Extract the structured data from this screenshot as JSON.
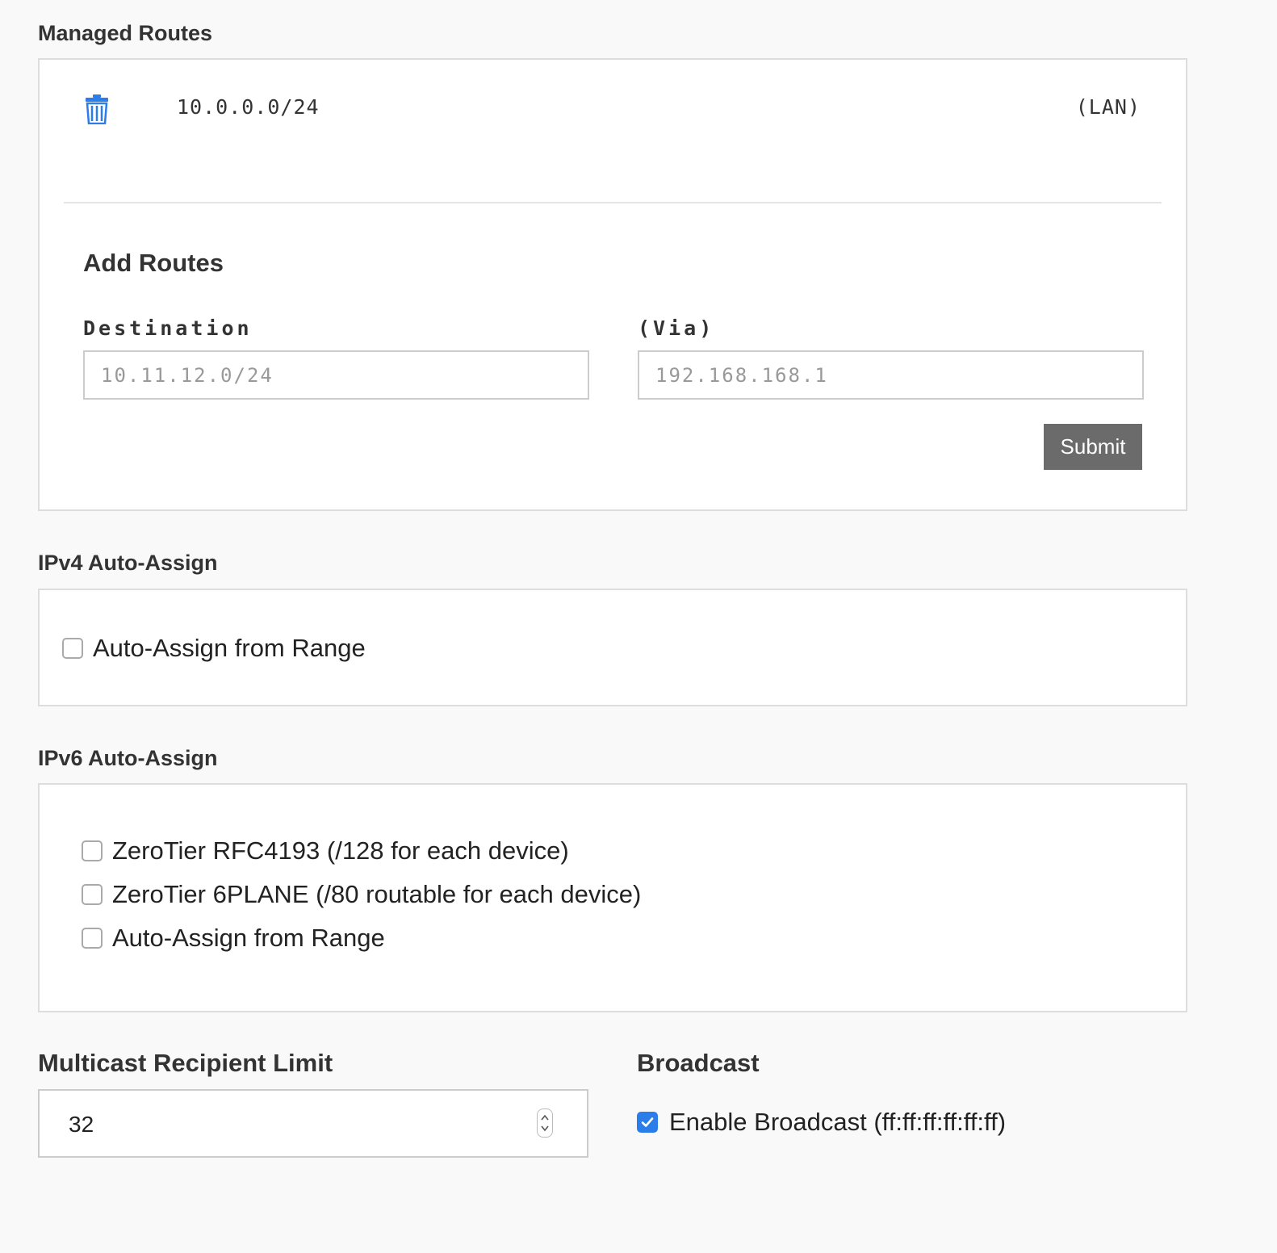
{
  "managed_routes": {
    "title": "Managed Routes",
    "routes": [
      {
        "destination": "10.0.0.0/24",
        "via": "(LAN)"
      }
    ],
    "add_routes": {
      "title": "Add Routes",
      "destination_label": "Destination",
      "destination_placeholder": "10.11.12.0/24",
      "via_label": "(Via)",
      "via_placeholder": "192.168.168.1",
      "submit_label": "Submit"
    }
  },
  "ipv4": {
    "title": "IPv4 Auto-Assign",
    "options": [
      {
        "label": "Auto-Assign from Range",
        "checked": false
      }
    ]
  },
  "ipv6": {
    "title": "IPv6 Auto-Assign",
    "options": [
      {
        "label": "ZeroTier RFC4193 (/128 for each device)",
        "checked": false
      },
      {
        "label": "ZeroTier 6PLANE (/80 routable for each device)",
        "checked": false
      },
      {
        "label": "Auto-Assign from Range",
        "checked": false
      }
    ]
  },
  "multicast": {
    "title": "Multicast Recipient Limit",
    "value": "32"
  },
  "broadcast": {
    "title": "Broadcast",
    "label": "Enable Broadcast (ff:ff:ff:ff:ff:ff)",
    "checked": true
  },
  "colors": {
    "accent": "#2b7de9",
    "submit_bg": "#6b6b6b"
  },
  "icons": {
    "delete_route": "trash-icon",
    "checked": "checkmark-icon",
    "spinner": "spinner-arrows-icon"
  }
}
